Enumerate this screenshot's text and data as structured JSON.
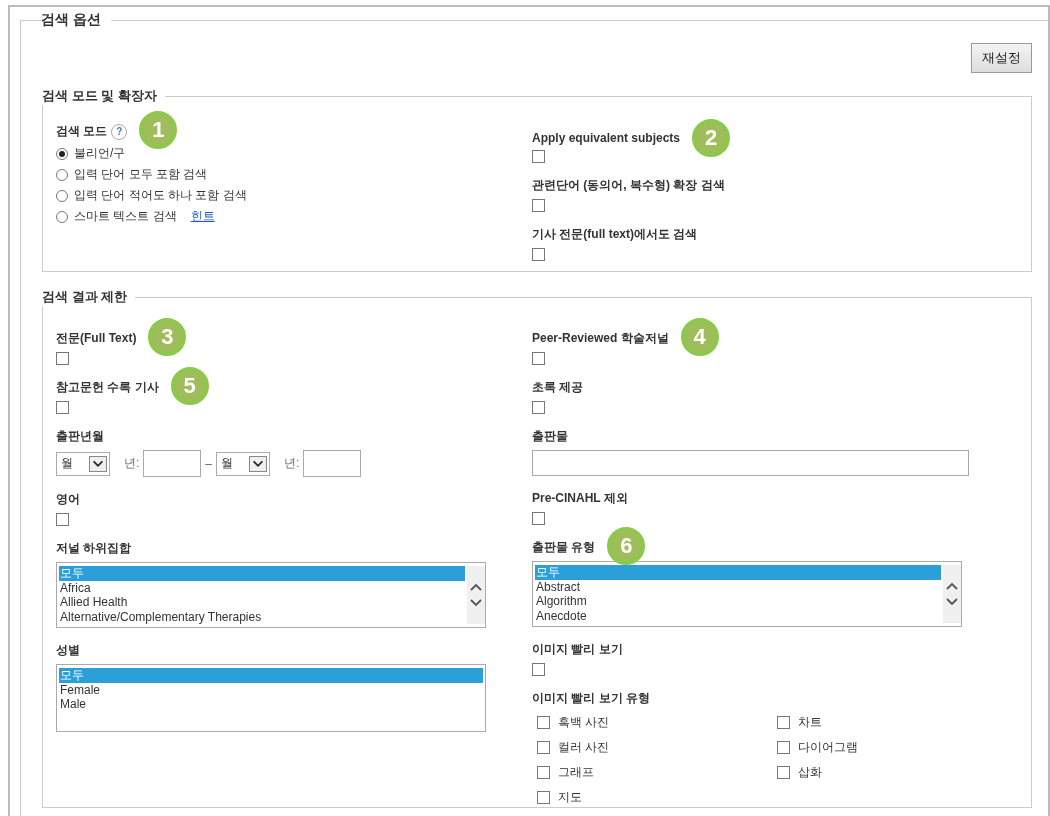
{
  "panel": {
    "title": "검색 옵션",
    "reset_button": "재설정"
  },
  "mode_section": {
    "title": "검색 모드 및 확장자",
    "mode_label": "검색 모드",
    "help": "?",
    "badge": "1",
    "expanders_badge": "2",
    "modes": [
      {
        "label": "불리언/구",
        "selected": true
      },
      {
        "label": "입력 단어 모두 포함 검색",
        "selected": false
      },
      {
        "label": "입력 단어 적어도 하나 포함 검색",
        "selected": false
      },
      {
        "label": "스마트 텍스트 검색",
        "selected": false,
        "link": "힌트"
      }
    ],
    "expanders": [
      {
        "label": "Apply equivalent subjects",
        "checked": false
      },
      {
        "label": "관련단어 (동의어, 복수형) 확장 검색",
        "checked": false
      },
      {
        "label": "기사 전문(full text)에서도 검색",
        "checked": false
      }
    ]
  },
  "limit_section": {
    "title": "검색 결과 제한",
    "left": [
      {
        "kind": "checkbox",
        "label": "전문(Full Text)",
        "checked": false,
        "badge": "3"
      },
      {
        "kind": "checkbox",
        "label": "참고문헌 수록 기사",
        "checked": false,
        "badge": "5"
      },
      {
        "kind": "date_range",
        "label": "출판년월",
        "from_month": "월",
        "from_year_label": "년:",
        "separator": "–",
        "to_month": "월",
        "to_year_label": "년:"
      },
      {
        "kind": "checkbox",
        "label": "영어",
        "checked": false
      },
      {
        "kind": "listbox",
        "label": "저널 하위집합",
        "scrollbar": true,
        "options": [
          {
            "label": "모두",
            "selected": true
          },
          {
            "label": "Africa",
            "selected": false
          },
          {
            "label": "Allied Health",
            "selected": false
          },
          {
            "label": "Alternative/Complementary Therapies",
            "selected": false
          }
        ]
      },
      {
        "kind": "listbox",
        "label": "성별",
        "scrollbar": false,
        "options": [
          {
            "label": "모두",
            "selected": true
          },
          {
            "label": "Female",
            "selected": false
          },
          {
            "label": "Male",
            "selected": false
          }
        ]
      }
    ],
    "right": [
      {
        "kind": "checkbox",
        "label": "Peer-Reviewed 학술저널",
        "checked": false,
        "badge": "4"
      },
      {
        "kind": "checkbox",
        "label": "초록 제공",
        "checked": false
      },
      {
        "kind": "text_field",
        "label": "출판물"
      },
      {
        "kind": "checkbox",
        "label": "Pre-CINAHL 제외",
        "checked": false
      },
      {
        "kind": "listbox",
        "label": "출판물 유형",
        "scrollbar": true,
        "badge": "6",
        "options": [
          {
            "label": "모두",
            "selected": true
          },
          {
            "label": "Abstract",
            "selected": false
          },
          {
            "label": "Algorithm",
            "selected": false
          },
          {
            "label": "Anecdote",
            "selected": false
          }
        ]
      },
      {
        "kind": "checkbox",
        "label": "이미지 빨리 보기",
        "checked": false
      },
      {
        "kind": "checkgroup",
        "label": "이미지 빨리 보기 유형",
        "options": [
          {
            "label": "흑백 사진",
            "checked": false
          },
          {
            "label": "컬러 사진",
            "checked": false
          },
          {
            "label": "그래프",
            "checked": false
          },
          {
            "label": "지도",
            "checked": false
          },
          {
            "label": "차트",
            "checked": false
          },
          {
            "label": "다이어그램",
            "checked": false
          },
          {
            "label": "삽화",
            "checked": false
          }
        ]
      }
    ]
  }
}
